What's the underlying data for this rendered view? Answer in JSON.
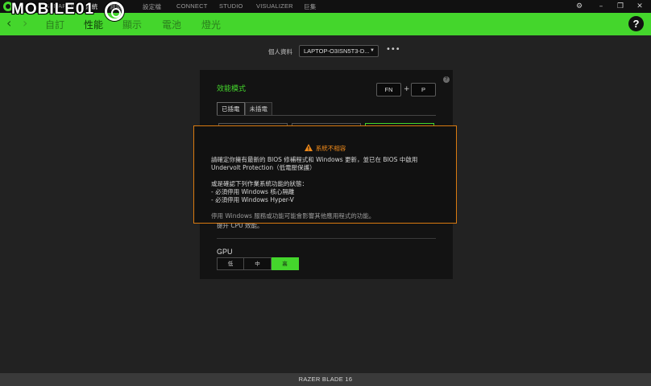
{
  "watermark": "MOBILE01",
  "top_nav": {
    "items": [
      "SYNAPSE",
      "系統",
      "測試",
      "設定檔",
      "CONNECT",
      "STUDIO",
      "VISUALIZER",
      "巨集"
    ]
  },
  "window_controls": {
    "settings": "⚙",
    "minimize": "–",
    "restore": "❐",
    "close": "✕"
  },
  "sub_nav": {
    "back": "‹",
    "forward": "›",
    "tabs": [
      {
        "label": "自訂",
        "active": false
      },
      {
        "label": "性能",
        "active": true
      },
      {
        "label": "顯示",
        "active": false
      },
      {
        "label": "電池",
        "active": false
      },
      {
        "label": "燈光",
        "active": false
      }
    ],
    "help": "?"
  },
  "profile": {
    "label": "個人資料",
    "value": "LAPTOP-O3ISN5T3-D...",
    "more": "•••"
  },
  "panel": {
    "title": "效能模式",
    "hotkey": {
      "key1": "FN",
      "plus": "+",
      "key2": "P"
    },
    "help": "?",
    "power_tabs": [
      "已插電",
      "未插電"
    ],
    "partial_text": "提升 CPU 效能。",
    "gpu": {
      "label": "GPU",
      "options": [
        "低",
        "中",
        "高"
      ],
      "selected": "高"
    }
  },
  "modal": {
    "title": "系統不相容",
    "line1": "請確定你擁有最新的 BIOS 修補程式和 Windows 更新，並已在 BIOS 中啟用 Undervolt Protection（低電壓保護）",
    "line2": "或是確認下列作業系統功能的狀態：",
    "line3": "- 必須停用 Windows 核心隔離",
    "line4": "- 必須停用 Windows Hyper-V",
    "note": "停用 Windows 服務或功能可能會影響其他應用程式的功能。"
  },
  "footer": {
    "device": "RAZER BLADE 16"
  },
  "colors": {
    "accent": "#44d62c",
    "warning": "#f08a1a",
    "modal_border": "#d97a10",
    "background": "#222222"
  }
}
